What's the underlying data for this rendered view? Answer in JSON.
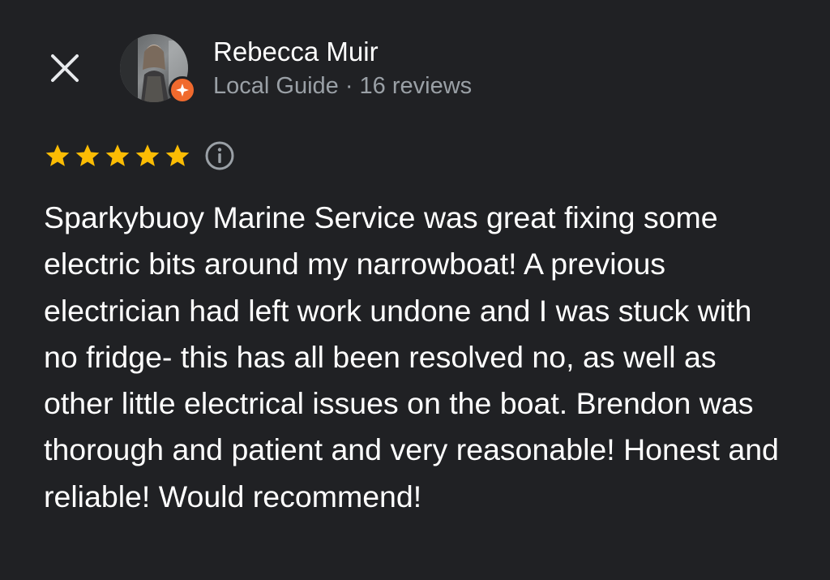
{
  "header": {
    "close_icon": "close-icon",
    "reviewer": {
      "name": "Rebecca Muir",
      "meta": "Local Guide · 16 reviews",
      "avatar_icon": "avatar-photo",
      "badge_icon": "local-guide-star-icon",
      "badge_color": "#f06a2e"
    }
  },
  "review": {
    "rating": 5,
    "max_rating": 5,
    "star_color": "#fbbc04",
    "info_icon": "info-icon",
    "text": "Sparkybuoy Marine Service was great fixing some electric bits around my narrowboat! A previous electrician had left work undone and I was stuck with no fridge- this has all been resolved no, as well as other little electrical issues on the boat. Brendon was thorough and patient and very reasonable! Honest and reliable! Would recommend!"
  },
  "theme": {
    "background": "#202124",
    "primary_text": "#ffffff",
    "secondary_text": "#9aa0a6"
  }
}
